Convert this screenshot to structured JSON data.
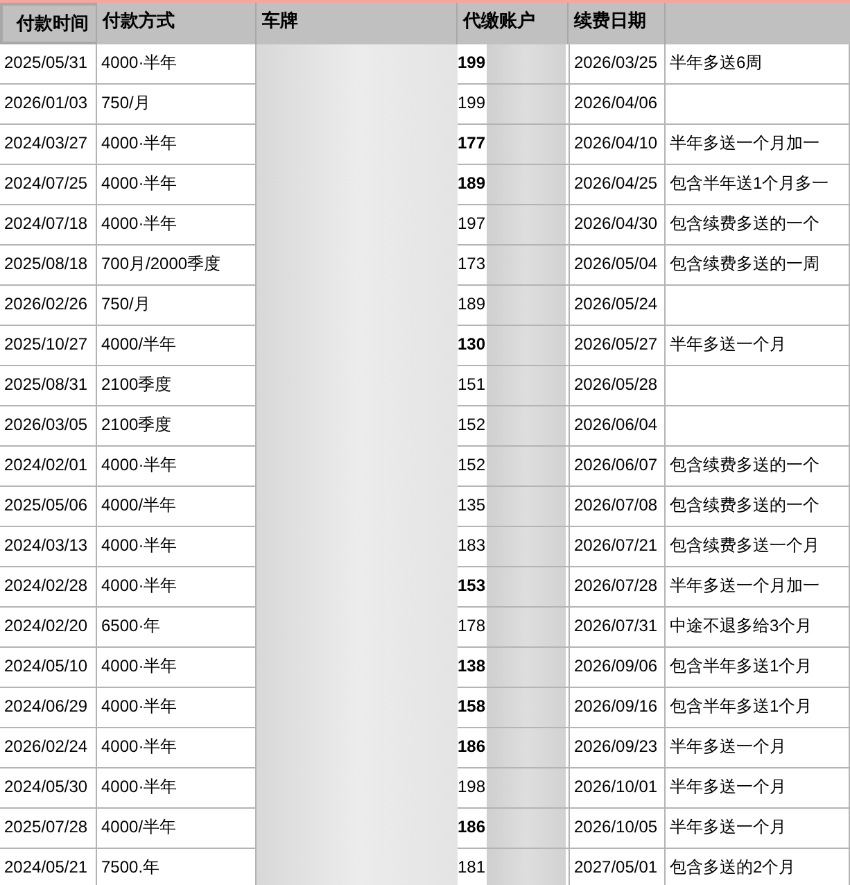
{
  "columns": [
    "付款时间",
    "付款方式",
    "车牌",
    "代缴账户",
    "续费日期"
  ],
  "rows": [
    {
      "paid": "2025/05/31",
      "method": "4000·半年",
      "account": "199",
      "bold": true,
      "renew": "2026/03/25",
      "note": "半年多送6周"
    },
    {
      "paid": "2026/01/03",
      "method": "750/月",
      "account": "199",
      "bold": false,
      "renew": "2026/04/06"
    },
    {
      "paid": "2024/03/27",
      "method": "4000·半年",
      "account": "177",
      "bold": true,
      "renew": "2026/04/10",
      "note": "半年多送一个月加一"
    },
    {
      "paid": "2024/07/25",
      "method": "4000·半年",
      "account": "189",
      "bold": true,
      "renew": "2026/04/25",
      "note": "包含半年送1个月多一"
    },
    {
      "paid": "2024/07/18",
      "method": "4000·半年",
      "account": "197",
      "bold": false,
      "renew": "2026/04/30",
      "note": "包含续费多送的一个"
    },
    {
      "paid": "2025/08/18",
      "method": "700月/2000季度",
      "account": "173",
      "bold": false,
      "renew": "2026/05/04",
      "note": "包含续费多送的一周"
    },
    {
      "paid": "2026/02/26",
      "method": "750/月",
      "account": "189",
      "bold": false,
      "renew": "2026/05/24"
    },
    {
      "paid": "2025/10/27",
      "method": "4000/半年",
      "account": "130",
      "bold": true,
      "renew": "2026/05/27",
      "note": "半年多送一个月"
    },
    {
      "paid": "2025/08/31",
      "method": "2100季度",
      "account": "151",
      "bold": false,
      "renew": "2026/05/28"
    },
    {
      "paid": "2026/03/05",
      "method": "2100季度",
      "account": "152",
      "bold": false,
      "renew": "2026/06/04"
    },
    {
      "paid": "2024/02/01",
      "method": "4000·半年",
      "account": "152",
      "bold": false,
      "renew": "2026/06/07",
      "note": "包含续费多送的一个"
    },
    {
      "paid": "2025/05/06",
      "method": "4000/半年",
      "account": "135",
      "bold": false,
      "renew": "2026/07/08",
      "note": "包含续费多送的一个"
    },
    {
      "paid": "2024/03/13",
      "method": "4000·半年",
      "account": "183",
      "bold": false,
      "renew": "2026/07/21",
      "note": "包含续费多送一个月"
    },
    {
      "paid": "2024/02/28",
      "method": "4000·半年",
      "account": "153",
      "bold": true,
      "renew": "2026/07/28",
      "note": "半年多送一个月加一"
    },
    {
      "paid": "2024/02/20",
      "method": "6500·年",
      "account": "178",
      "bold": false,
      "renew": "2026/07/31",
      "note": "中途不退多给3个月"
    },
    {
      "paid": "2024/05/10",
      "method": "4000·半年",
      "account": "138",
      "bold": true,
      "renew": "2026/09/06",
      "note": "包含半年多送1个月"
    },
    {
      "paid": "2024/06/29",
      "method": "4000·半年",
      "account": "158",
      "bold": true,
      "renew": "2026/09/16",
      "note": "包含半年多送1个月"
    },
    {
      "paid": "2026/02/24",
      "method": "4000·半年",
      "account": "186",
      "bold": true,
      "renew": "2026/09/23",
      "note": "半年多送一个月"
    },
    {
      "paid": "2024/05/30",
      "method": "4000·半年",
      "account": "198",
      "bold": false,
      "renew": "2026/10/01",
      "note": "半年多送一个月"
    },
    {
      "paid": "2025/07/28",
      "method": "4000/半年",
      "account": "186",
      "bold": true,
      "renew": "2026/10/05",
      "note": "半年多送一个月"
    },
    {
      "paid": "2024/05/21",
      "method": "7500.年",
      "account": "181",
      "bold": false,
      "renew": "2027/05/01",
      "note": "包含多送的2个月"
    }
  ]
}
